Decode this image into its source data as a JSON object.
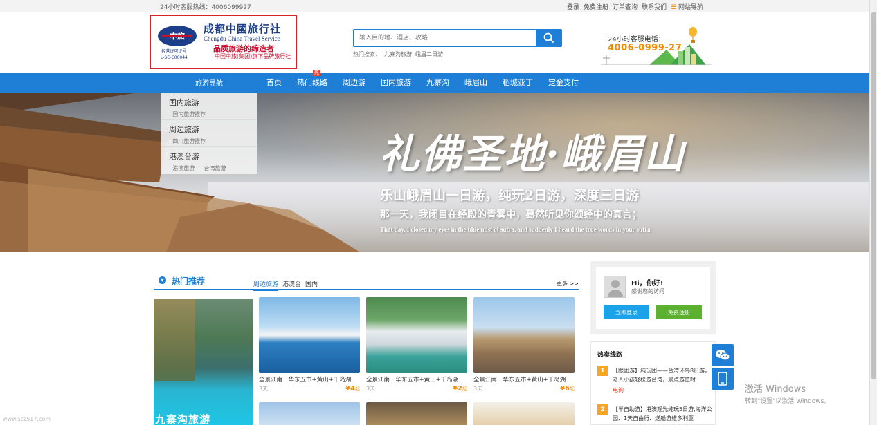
{
  "topbar": {
    "hotline": "24小时客服热线：4006099927",
    "links": [
      "登录",
      "免费注册",
      "订单查询",
      "联系我们"
    ],
    "site_nav": "网站导航"
  },
  "logo": {
    "emblem": "中旅",
    "title": "成都中國旅行社",
    "english": "Chengdu China Travel Service",
    "slogan": "品质旅游的缔造者",
    "subline": "中国中旅(集团)旗下品牌旅行社",
    "license_label": "经营许可证号",
    "license_no": "L-SC-C00044"
  },
  "search": {
    "placeholder": "输入目的地、酒店、攻略",
    "hot_label": "热门搜索：",
    "hot_terms": [
      "九寨沟旅游",
      "峨眉二日游"
    ]
  },
  "contact": {
    "label": "24小时客服电话：",
    "number": "4006-0999-27"
  },
  "nav": {
    "guide": "旅游导航",
    "items": [
      "首页",
      "热门线路",
      "周边游",
      "国内旅游",
      "九寨沟",
      "峨眉山",
      "稻城亚丁",
      "定金支付"
    ],
    "hot_badge": "热"
  },
  "side_menu": [
    {
      "title": "国内旅游",
      "subs": [
        "国内旅游推荐"
      ]
    },
    {
      "title": "周边旅游",
      "subs": [
        "四川旅游推荐"
      ]
    },
    {
      "title": "港澳台游",
      "subs": [
        "港澳旅游",
        "台湾旅游"
      ]
    }
  ],
  "banner": {
    "title": "礼佛圣地·峨眉山",
    "sub1": "乐山峨眉山一日游，纯玩2日游，深度三日游",
    "sub2": "那一天，我闭目在经殿的青雾中，蓦然听见你颂经中的真言；",
    "english": "That day, I closed my eyes in the blue mist of sutra, and suddenly I heard the true words in your sutra."
  },
  "hot_section": {
    "title": "热门推荐",
    "tabs": [
      "周边旅游",
      "港澳台",
      "国内"
    ],
    "more": "更多 >>",
    "feature_text": "九寨沟旅游",
    "cards": [
      {
        "name": "全景江南一华东五市+黄山+千岛湖",
        "days": "3天",
        "price": "¥4",
        "unit": "起"
      },
      {
        "name": "全景江南一华东五市+黄山+千岛湖",
        "days": "3天",
        "price": "¥2",
        "unit": "起"
      },
      {
        "name": "全景江南一华东五市+黄山+千岛湖",
        "days": "3天",
        "price": "¥6",
        "unit": "起"
      }
    ]
  },
  "user_panel": {
    "greeting": "Hi，你好!",
    "thanks": "感谢您的访问",
    "login": "立即登录",
    "register": "免费注册"
  },
  "hot_routes": {
    "title": "热卖线路",
    "items": [
      {
        "num": "1",
        "text": "【跟团游】纯玩团——台湾环岛8日游。老人小孩轻松游台湾，景点游览时",
        "tag": "电询"
      },
      {
        "num": "2",
        "text": "【半自助游】港澳观光纯玩5日游,海洋公园、1天自由行、送船游维多利亚",
        "tag": ""
      }
    ]
  },
  "watermark": {
    "line1": "激活 Windows",
    "line2": "转到\"设置\"以激活 Windows。"
  },
  "site_mark": "www.scz517.com",
  "colors": {
    "primary": "#1f7fd6",
    "accent": "#f28c00",
    "login_button": "#1aa3e8",
    "register_button": "#5cb130",
    "logo_border": "#d9232a"
  }
}
